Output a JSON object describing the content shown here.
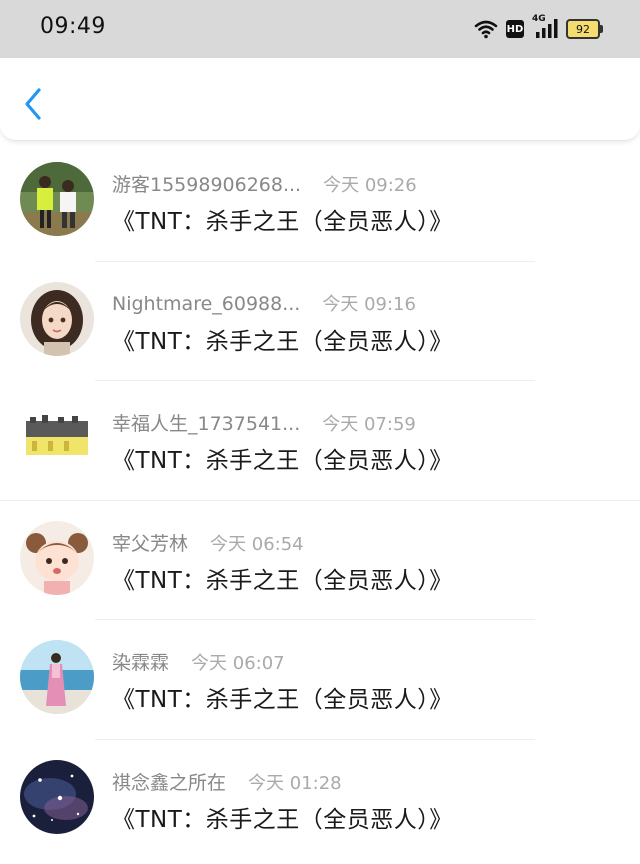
{
  "status_bar": {
    "time": "09:49",
    "network": "4G",
    "hd": "HD",
    "battery": "92"
  },
  "header": {
    "back_icon": "chevron-left-icon",
    "accent_color": "#2196f3"
  },
  "comments": [
    {
      "username": "游客15598906268...",
      "time": "今天 09:26",
      "text": "《TNT：杀手之王（全员恶人）》"
    },
    {
      "username": "Nightmare_60988...",
      "time": "今天 09:16",
      "text": "《TNT：杀手之王（全员恶人）》"
    },
    {
      "username": "幸福人生_1737541...",
      "time": "今天 07:59",
      "text": "《TNT：杀手之王（全员恶人）》"
    },
    {
      "username": "宰父芳林",
      "time": "今天 06:54",
      "text": "《TNT：杀手之王（全员恶人）》"
    },
    {
      "username": "染霖霖",
      "time": "今天 06:07",
      "text": "《TNT：杀手之王（全员恶人）》"
    },
    {
      "username": "祺念鑫之所在",
      "time": "今天 01:28",
      "text": "《TNT：杀手之王（全员恶人）》"
    }
  ]
}
